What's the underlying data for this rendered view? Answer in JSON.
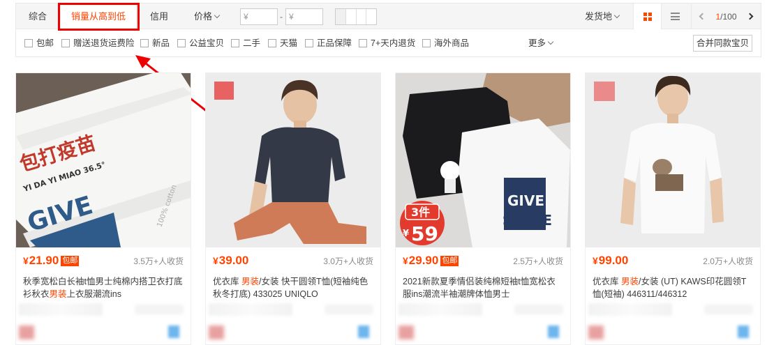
{
  "sort": {
    "default_label": "综合",
    "sales_label": "销量从高到低",
    "credit_label": "信用",
    "price_label": "价格",
    "price_min_placeholder": "¥",
    "price_max_placeholder": "¥",
    "price_dash": "-",
    "ship_from_label": "发货地",
    "pager_current": "1",
    "pager_total": "/100"
  },
  "options": [
    {
      "label": "包邮"
    },
    {
      "label": "赠送退货运费险"
    },
    {
      "label": "新品"
    },
    {
      "label": "公益宝贝"
    },
    {
      "label": "二手"
    },
    {
      "label": "天猫"
    },
    {
      "label": "正品保障"
    },
    {
      "label": "7+天内退货"
    },
    {
      "label": "海外商品"
    }
  ],
  "more_label": "更多",
  "merge_label": "合并同款宝贝",
  "products": [
    {
      "yen": "¥",
      "price": "21.90",
      "tag": "包邮",
      "sales": "3.5万+人收货",
      "title_a": "秋季宽松白长袖t恤男士纯棉内搭卫衣打底衫秋衣",
      "title_hl": "男装",
      "title_b": "上衣服潮流ins"
    },
    {
      "yen": "¥",
      "price": "39.00",
      "tag": "",
      "sales": "3.0万+人收货",
      "title_a": "优衣库 ",
      "title_hl": "男装",
      "title_b": "/女装 快干圆领T恤(短袖纯色秋冬打底) 433025 UNIQLO"
    },
    {
      "yen": "¥",
      "price": "29.90",
      "tag": "包邮",
      "sales": "2.5万+人收货",
      "title_a": "2021新款夏季情侣装纯棉短袖t恤宽松衣服ins潮流半袖潮牌体恤男士",
      "title_hl": "",
      "title_b": ""
    },
    {
      "yen": "¥",
      "price": "99.00",
      "tag": "",
      "sales": "2.0万+人收货",
      "title_a": "优衣库 ",
      "title_hl": "男装",
      "title_b": "/女装 (UT) KAWS印花圆领T恤(短袖) 446311/446312"
    }
  ],
  "images": {
    "p1_text_cn": "包打疫苗",
    "p1_text_py": "YI DA YI MIAO 36.5°",
    "p1_text_give": "GIVE",
    "p1_text_cotton": "100% cotton",
    "p3_promo_top": "3件",
    "p3_promo_yen": "¥",
    "p3_promo_num": "59",
    "p3_text_1": "GIVE",
    "p3_text_2": "SPACE"
  },
  "colors": {
    "accent": "#ff4400",
    "annotation": "#e00000"
  }
}
